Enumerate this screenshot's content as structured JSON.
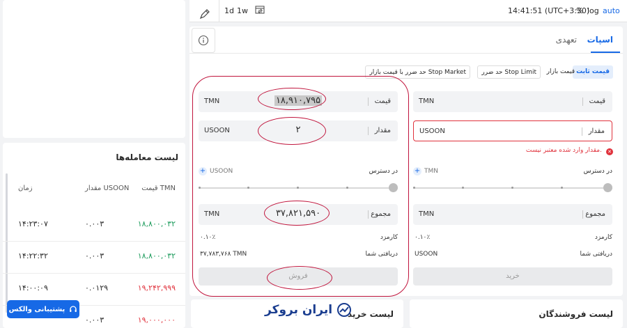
{
  "toolbar": {
    "interval_1d": "1d",
    "interval_1w": "1w",
    "clock": "14:41:51 (UTC+3:30)",
    "percent": "%",
    "log": "log",
    "auto": "auto"
  },
  "tabs": {
    "spot": "اسپات",
    "margin": "تعهدی"
  },
  "order_types": [
    "قیمت ثابت",
    "قیمت بازار",
    "حد ضرر Stop Limit",
    "حد ضرر با قیمت بازار Stop Market"
  ],
  "buy": {
    "price_label": "قیمت",
    "price_unit": "TMN",
    "amount_label": "مقدار",
    "amount_unit": "USOON",
    "error_text": "مقدار وارد شده معتبر نیست.",
    "available_label": "در دسترس",
    "available_unit": "TMN",
    "total_label": "مجموع",
    "total_unit": "TMN",
    "fee_label": "کارمزد",
    "fee_value": "۰.۱۰٪",
    "receive_label": "دریافتی شما",
    "receive_value": "USOON",
    "button": "خرید"
  },
  "sell": {
    "price_label": "قیمت",
    "price_unit": "TMN",
    "price_value": "۱۸,۹۱۰,۷۹۵",
    "amount_label": "مقدار",
    "amount_unit": "USOON",
    "amount_value": "۲",
    "available_label": "در دسترس",
    "available_unit": "USOON",
    "total_label": "مجموع",
    "total_unit": "TMN",
    "total_value": "۳۷,۸۲۱,۵۹۰",
    "fee_label": "کارمزد",
    "fee_value": "۰.۱۰٪",
    "receive_label": "دریافتی شما",
    "receive_value": "۳۷,۷۸۳,۷۶۸ TMN",
    "button": "فروش"
  },
  "trades": {
    "title": "لیست معامله‌ها",
    "headers": {
      "price": "قیمت TMN",
      "amount": "مقدار USOON",
      "time": "زمان"
    },
    "rows": [
      {
        "price": "۱۸,۸۰۰,۰۳۲",
        "amount": "۰.۰۰۳",
        "time": "۱۴:۲۳:۰۷",
        "side": "buy"
      },
      {
        "price": "۱۸,۸۰۰,۰۳۲",
        "amount": "۰.۰۰۳",
        "time": "۱۴:۲۲:۳۲",
        "side": "buy"
      },
      {
        "price": "۱۹,۲۴۲,۹۹۹",
        "amount": "۰.۰۱۲۹",
        "time": "۱۴:۰۰:۰۹",
        "side": "sell"
      },
      {
        "price": "۱۹,۰۰۰,۰۰۰",
        "amount": "۰.۰۰۳",
        "time": "",
        "side": "sell"
      }
    ]
  },
  "support_button": "پشتیبانی والکس",
  "logo_text": "ایران بروکر",
  "bottom": {
    "buy_list": "لیست خرید",
    "sell_list": "لیست فروشندگان"
  },
  "colors": {
    "accent": "#1769e6",
    "buy_green": "#1a9a5a",
    "sell_red": "#e0323c",
    "annotation": "#c0143c"
  }
}
